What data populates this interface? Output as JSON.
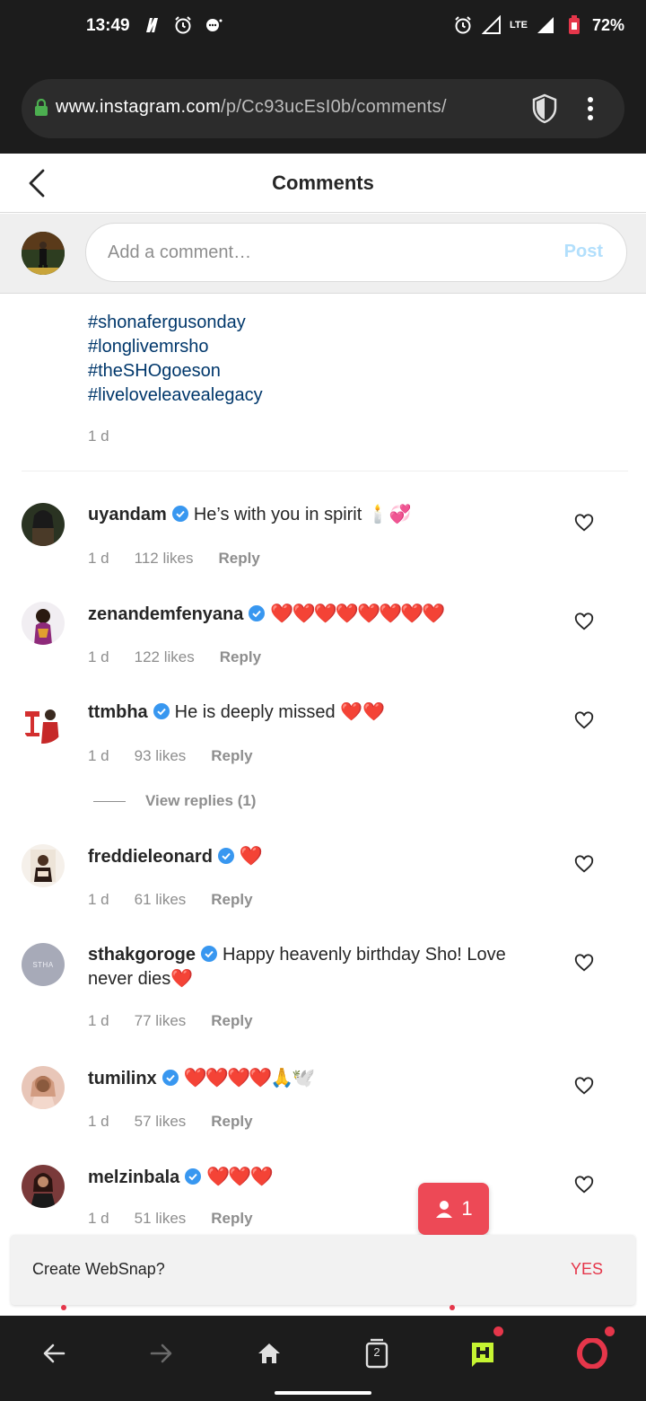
{
  "status_bar": {
    "time": "13:49",
    "battery": "72%",
    "network": "LTE"
  },
  "browser": {
    "url_host": "www.instagram.com",
    "url_path": "/p/Cc93ucEsI0b/comments/"
  },
  "header": {
    "title": "Comments"
  },
  "add_comment": {
    "placeholder": "Add a comment…",
    "post_label": "Post"
  },
  "caption": {
    "hashtags": [
      "#shonafergusonday",
      "#longlivemrsho",
      "#theSHOgoeson",
      "#liveloveleavealegacy"
    ],
    "time": "1 d"
  },
  "comments": [
    {
      "user": "uyandam",
      "text": "He’s with you in spirit 🕯️💞",
      "time": "1 d",
      "likes": "112 likes",
      "reply": "Reply"
    },
    {
      "user": "zenandemfenyana",
      "text": "❤️❤️❤️❤️❤️❤️❤️❤️",
      "time": "1 d",
      "likes": "122 likes",
      "reply": "Reply"
    },
    {
      "user": "ttmbha",
      "text": "He is deeply missed ❤️❤️",
      "time": "1 d",
      "likes": "93 likes",
      "reply": "Reply"
    },
    {
      "user": "freddieleonard",
      "text": "❤️",
      "time": "1 d",
      "likes": "61 likes",
      "reply": "Reply"
    },
    {
      "user": "sthakgoroge",
      "text": "Happy heavenly birthday Sho! Love never dies❤️",
      "time": "1 d",
      "likes": "77 likes",
      "reply": "Reply",
      "avatar_text": "STHA"
    },
    {
      "user": "tumilinx",
      "text": "❤️❤️❤️❤️🙏🕊️",
      "time": "1 d",
      "likes": "57 likes",
      "reply": "Reply"
    },
    {
      "user": "melzinbala",
      "text": "❤️❤️❤️",
      "time": "1 d",
      "likes": "51 likes",
      "reply": "Reply"
    }
  ],
  "view_replies": "View replies (1)",
  "floating_badge": {
    "count": "1"
  },
  "websnap": {
    "question": "Create WebSnap?",
    "yes_label": "YES"
  },
  "bottom_nav": {
    "tabs_count": "2"
  },
  "colors": {
    "hashtag": "#00376b",
    "muted": "#8e8e8e",
    "verified": "#3897f0",
    "badge": "#ed4956",
    "opera_red": "#e5364a"
  }
}
